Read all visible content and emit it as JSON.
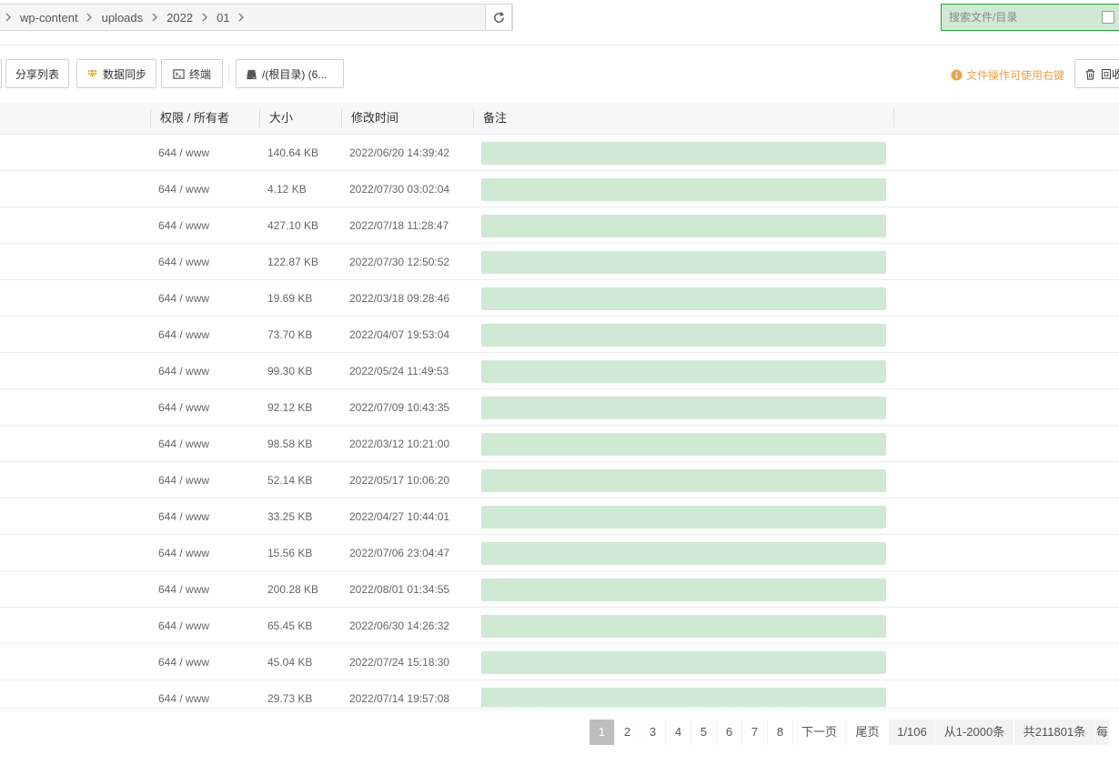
{
  "breadcrumb": {
    "items": [
      "wp-content",
      "uploads",
      "2022",
      "01"
    ]
  },
  "search": {
    "placeholder": "搜索文件/目录"
  },
  "toolbar": {
    "share_label": "分享列表",
    "sync_label": "数据同步",
    "terminal_label": "终端",
    "disk_label": "/(根目录) (6...",
    "hint_text": "文件操作可使用右键",
    "recycle_label": "回收"
  },
  "colors": {
    "accent_green": "#20a53a",
    "hint_orange": "#f0a14a",
    "note_field_bg": "#cfe9d3",
    "pager_active": "#bdbdbd"
  },
  "table": {
    "headers": {
      "perm": "权限 / 所有者",
      "size": "大小",
      "time": "修改时间",
      "note": "备注"
    },
    "rows": [
      {
        "perm": "644 / www",
        "size": "140.64 KB",
        "time": "2022/06/20 14:39:42"
      },
      {
        "perm": "644 / www",
        "size": "4.12 KB",
        "time": "2022/07/30 03:02:04"
      },
      {
        "perm": "644 / www",
        "size": "427.10 KB",
        "time": "2022/07/18 11:28:47"
      },
      {
        "perm": "644 / www",
        "size": "122.87 KB",
        "time": "2022/07/30 12:50:52"
      },
      {
        "perm": "644 / www",
        "size": "19.69 KB",
        "time": "2022/03/18 09:28:46"
      },
      {
        "perm": "644 / www",
        "size": "73.70 KB",
        "time": "2022/04/07 19:53:04"
      },
      {
        "perm": "644 / www",
        "size": "99.30 KB",
        "time": "2022/05/24 11:49:53"
      },
      {
        "perm": "644 / www",
        "size": "92.12 KB",
        "time": "2022/07/09 10:43:35"
      },
      {
        "perm": "644 / www",
        "size": "98.58 KB",
        "time": "2022/03/12 10:21:00"
      },
      {
        "perm": "644 / www",
        "size": "52.14 KB",
        "time": "2022/05/17 10:06:20"
      },
      {
        "perm": "644 / www",
        "size": "33.25 KB",
        "time": "2022/04/27 10:44:01"
      },
      {
        "perm": "644 / www",
        "size": "15.56 KB",
        "time": "2022/07/06 23:04:47"
      },
      {
        "perm": "644 / www",
        "size": "200.28 KB",
        "time": "2022/08/01 01:34:55"
      },
      {
        "perm": "644 / www",
        "size": "65.45 KB",
        "time": "2022/06/30 14:26:32"
      },
      {
        "perm": "644 / www",
        "size": "45.04 KB",
        "time": "2022/07/24 15:18:30"
      },
      {
        "perm": "644 / www",
        "size": "29.73 KB",
        "time": "2022/07/14 19:57:08"
      }
    ]
  },
  "pagination": {
    "pages": [
      "1",
      "2",
      "3",
      "4",
      "5",
      "6",
      "7",
      "8"
    ],
    "current": "1",
    "next_label": "下一页",
    "last_label": "尾页",
    "page_info": "1/106",
    "range_info": "从1-2000条",
    "total_info": "共211801条",
    "per_page_label": "每"
  }
}
